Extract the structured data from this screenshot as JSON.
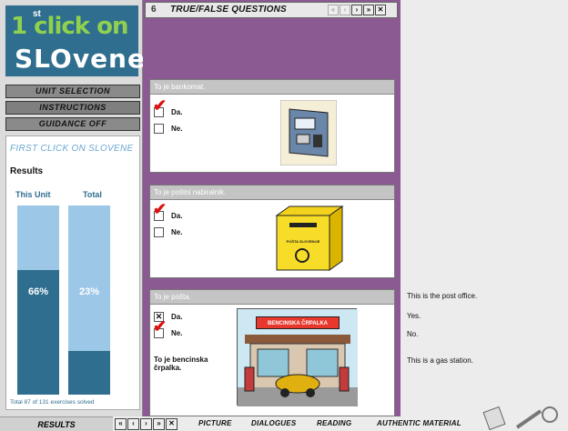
{
  "logo": {
    "sup": "st",
    "line1": "1 click on",
    "line2": "SLOvene"
  },
  "menu": [
    "Unit Selection",
    "Instructions",
    "Guidance Off"
  ],
  "results": {
    "course_title": "FIRST CLICK ON SLOVENE",
    "heading": "Results",
    "this_unit_label": "This Unit",
    "total_label": "Total",
    "this_unit_pct": "66%",
    "total_pct": "23%",
    "this_unit_value": 0.66,
    "total_value": 0.23,
    "footer": "Total 87 of 131 exercises solved"
  },
  "results_button": "RESULTS",
  "exercise": {
    "number": "6",
    "title": "TRUE/FALSE QUESTIONS",
    "nav": [
      "«",
      "‹",
      "›",
      "»",
      "✕"
    ]
  },
  "cards": [
    {
      "question": "To je bankomat.",
      "opt1": "Da.",
      "opt2": "Ne."
    },
    {
      "question": "To je poštni nabiralnik.",
      "opt1": "Da.",
      "opt2": "Ne.",
      "pic_label": "POŠTA SLOVENIJE"
    },
    {
      "question": "To je pošta.",
      "opt1": "Da.",
      "opt2": "Ne.",
      "answer": "To je bencinska črpalka.",
      "sign": "BENCINSKA ČRPALKA"
    }
  ],
  "right_panel": {
    "line1": "This is the post office.",
    "line2": "Yes.",
    "line3": "No.",
    "line4": "This is a gas station."
  },
  "bottom_nav": [
    "«",
    "‹",
    "›",
    "»",
    "✕"
  ],
  "tabs": [
    "PICTURE",
    "DIALOGUES",
    "READING",
    "AUTHENTIC MATERIAL"
  ],
  "colors": {
    "accent": "#2f6e8e",
    "purple": "#8c5a93",
    "bar_light": "#9cc7e6"
  }
}
